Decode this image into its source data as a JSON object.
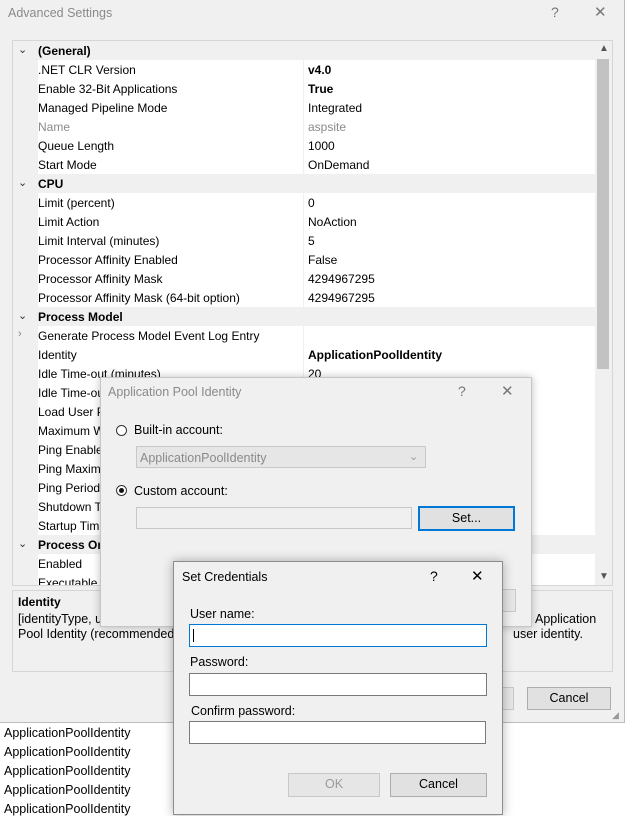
{
  "advanced": {
    "title": "Advanced Settings",
    "help_glyph": "?",
    "close_glyph": "✕",
    "rows": [
      {
        "type": "cat",
        "name": "(General)"
      },
      {
        "type": "prop",
        "name": ".NET CLR Version",
        "value": "v4.0",
        "bold": true
      },
      {
        "type": "prop",
        "name": "Enable 32-Bit Applications",
        "value": "True",
        "bold": true
      },
      {
        "type": "prop",
        "name": "Managed Pipeline Mode",
        "value": "Integrated"
      },
      {
        "type": "prop",
        "name": "Name",
        "value": "aspsite",
        "gray": true
      },
      {
        "type": "prop",
        "name": "Queue Length",
        "value": "1000"
      },
      {
        "type": "prop",
        "name": "Start Mode",
        "value": "OnDemand"
      },
      {
        "type": "cat",
        "name": "CPU"
      },
      {
        "type": "prop",
        "name": "Limit (percent)",
        "value": "0"
      },
      {
        "type": "prop",
        "name": "Limit Action",
        "value": "NoAction"
      },
      {
        "type": "prop",
        "name": "Limit Interval (minutes)",
        "value": "5"
      },
      {
        "type": "prop",
        "name": "Processor Affinity Enabled",
        "value": "False"
      },
      {
        "type": "prop",
        "name": "Processor Affinity Mask",
        "value": "4294967295"
      },
      {
        "type": "prop",
        "name": "Processor Affinity Mask (64-bit option)",
        "value": "4294967295"
      },
      {
        "type": "cat",
        "name": "Process Model"
      },
      {
        "type": "prop",
        "name": "Generate Process Model Event Log Entry",
        "value": "",
        "expander": "›"
      },
      {
        "type": "prop",
        "name": "Identity",
        "value": "ApplicationPoolIdentity",
        "bold": true
      },
      {
        "type": "prop",
        "name": "Idle Time-out (minutes)",
        "value": "20"
      },
      {
        "type": "prop",
        "name": "Idle Time-ou",
        "value": ""
      },
      {
        "type": "prop",
        "name": "Load User P",
        "value": ""
      },
      {
        "type": "prop",
        "name": "Maximum W",
        "value": ""
      },
      {
        "type": "prop",
        "name": "Ping Enable",
        "value": ""
      },
      {
        "type": "prop",
        "name": "Ping Maxim",
        "value": ""
      },
      {
        "type": "prop",
        "name": "Ping Period",
        "value": ""
      },
      {
        "type": "prop",
        "name": "Shutdown T",
        "value": ""
      },
      {
        "type": "prop",
        "name": "Startup Tim",
        "value": ""
      },
      {
        "type": "cat",
        "name": "Process Orp"
      },
      {
        "type": "prop",
        "name": "Enabled",
        "value": ""
      },
      {
        "type": "prop",
        "name": "Executable",
        "value": ""
      }
    ],
    "desc_title": "Identity",
    "desc_text_left": "[identityType, us",
    "desc_text_left2": "Pool Identity (recommended)",
    "desc_text_right": "Application",
    "desc_text_right2": "user identity.",
    "cancel_label": "Cancel"
  },
  "identity_dialog": {
    "title": "Application Pool Identity",
    "help_glyph": "?",
    "close_glyph": "✕",
    "builtin_label": "Built-in account:",
    "builtin_value": "ApplicationPoolIdentity",
    "custom_label": "Custom account:",
    "custom_value": "",
    "set_label": "Set..."
  },
  "cred_dialog": {
    "title": "Set Credentials",
    "help_glyph": "?",
    "close_glyph": "✕",
    "username_label": "User name:",
    "password_label": "Password:",
    "confirm_label": "Confirm password:",
    "ok_label": "OK",
    "cancel_label": "Cancel"
  },
  "background_list": [
    "ApplicationPoolIdentity",
    "ApplicationPoolIdentity",
    "ApplicationPoolIdentity",
    "ApplicationPoolIdentity",
    "ApplicationPoolIdentity"
  ]
}
